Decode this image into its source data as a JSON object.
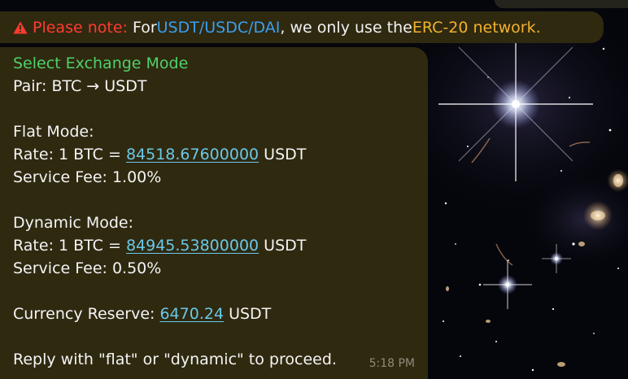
{
  "notice": {
    "icon": "warning-icon",
    "note_label": "Please note:",
    "text_before": "For ",
    "coins": "USDT/USDC/DAI",
    "text_middle": ", we only use the ",
    "network": "ERC-20 network.",
    "colors": {
      "warning": "#ff3b30",
      "coins": "#3a9ff0",
      "network": "#f2b22c"
    }
  },
  "message": {
    "title": "Select Exchange Mode",
    "pair": "Pair: BTC → USDT",
    "flat": {
      "heading": "Flat Mode:",
      "rate_prefix": "Rate: 1 BTC = ",
      "rate_value": "84518.67600000",
      "rate_unit": " USDT",
      "fee": "Service Fee: 1.00%"
    },
    "dynamic": {
      "heading": "Dynamic Mode:",
      "rate_prefix": "Rate: 1 BTC = ",
      "rate_value": "84945.53800000",
      "rate_unit": " USDT",
      "fee": "Service Fee: 0.50%"
    },
    "reserve": {
      "prefix": "Currency Reserve: ",
      "value": "6470.24",
      "unit": " USDT"
    },
    "reply_hint": "Reply with \"flat\" or \"dynamic\" to proceed.",
    "timestamp": "5:18 PM",
    "colors": {
      "title": "#4fd06a",
      "link": "#69c8e8",
      "bubble": "#2f2910"
    }
  }
}
